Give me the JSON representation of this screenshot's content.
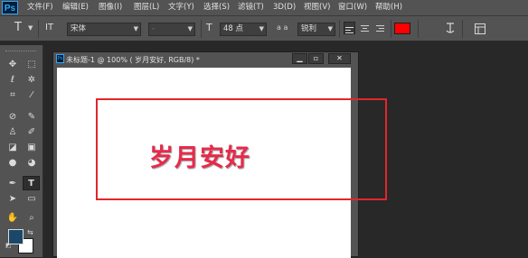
{
  "app": {
    "logo": "Ps"
  },
  "menu": [
    "文件(F)",
    "编辑(E)",
    "图像(I)",
    "图层(L)",
    "文字(Y)",
    "选择(S)",
    "滤镜(T)",
    "3D(D)",
    "视图(V)",
    "窗口(W)",
    "帮助(H)"
  ],
  "options": {
    "tool_icon": "T",
    "orient_icon": "IT",
    "font_family": "宋体",
    "font_style": "-",
    "size_icon": "T",
    "font_size": "48 点",
    "aa_icon": "a a",
    "antialias": "锐利",
    "text_color": "#ff0000"
  },
  "document": {
    "title": "未标题-1 @ 100% (    岁月安好, RGB/8) *",
    "canvas_text": "岁月安好",
    "text_color": "#e8294a"
  },
  "annotation": {
    "color": "#e2262a"
  },
  "toolbox": {
    "foreground_color": "#1b4868",
    "background_color": "#ffffff"
  }
}
